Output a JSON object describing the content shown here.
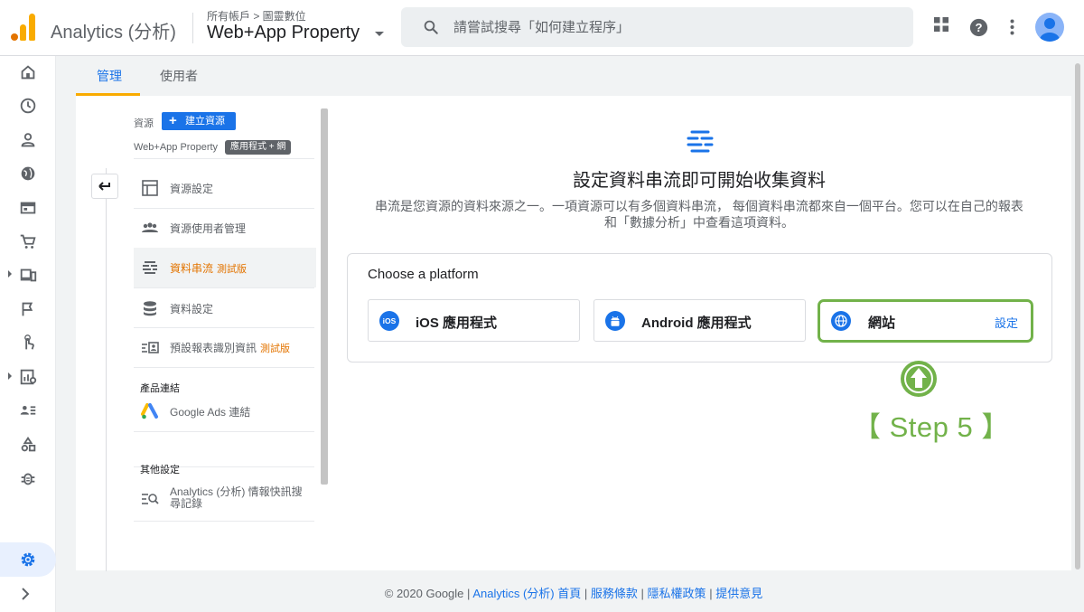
{
  "header": {
    "app_title": "Analytics (分析)",
    "breadcrumb": "所有帳戶 > 圖靈數位",
    "property_name": "Web+App Property",
    "search_placeholder": "請嘗試搜尋「如何建立程序」"
  },
  "tabs": [
    {
      "label": "管理"
    },
    {
      "label": "使用者"
    }
  ],
  "admin": {
    "resource_label": "資源",
    "create_resource_label": "建立資源",
    "property_label": "Web+App Property",
    "property_badge": "應用程式 + 網",
    "items": [
      {
        "label": "資源設定",
        "icon": "property-settings-icon"
      },
      {
        "label": "資源使用者管理",
        "icon": "users-icon"
      },
      {
        "label": "資料串流",
        "beta": "測試版",
        "icon": "data-streams-icon"
      },
      {
        "label": "資料設定",
        "icon": "database-icon"
      },
      {
        "label": "預設報表識別資訊",
        "beta": "測試版",
        "icon": "reporting-identity-icon"
      }
    ],
    "product_links_label": "產品連結",
    "google_ads_label": "Google Ads 連結",
    "other_settings_label": "其他設定",
    "intelligence_label_line1": "Analytics (分析) 情報快訊搜",
    "intelligence_label_line2": "尋記錄"
  },
  "main": {
    "title": "設定資料串流即可開始收集資料",
    "description_line1": "串流是您資源的資料來源之一。一項資源可以有多個資料串流， 每個資料串流都來自一個平台。您可以在自己的報表",
    "description_line2": "和「數據分析」中查看這項資料。",
    "choose_platform": "Choose a platform",
    "platforms": [
      {
        "label": "iOS 應用程式",
        "icon": "ios-icon",
        "icon_text": "iOS"
      },
      {
        "label": "Android 應用程式",
        "icon": "android-icon"
      },
      {
        "label": "網站",
        "icon": "web-globe-icon",
        "action": "設定"
      }
    ],
    "step_label": "【 Step 5 】"
  },
  "footer": {
    "copyright": "© 2020 Google",
    "sep": "|",
    "links": [
      "Analytics (分析) 首頁",
      "服務條款",
      "隱私權政策",
      "提供意見"
    ]
  },
  "colors": {
    "accent": "#1a73e8",
    "tab_underline": "#f9ab00",
    "beta": "#e37400",
    "step_green": "#72b24a"
  }
}
